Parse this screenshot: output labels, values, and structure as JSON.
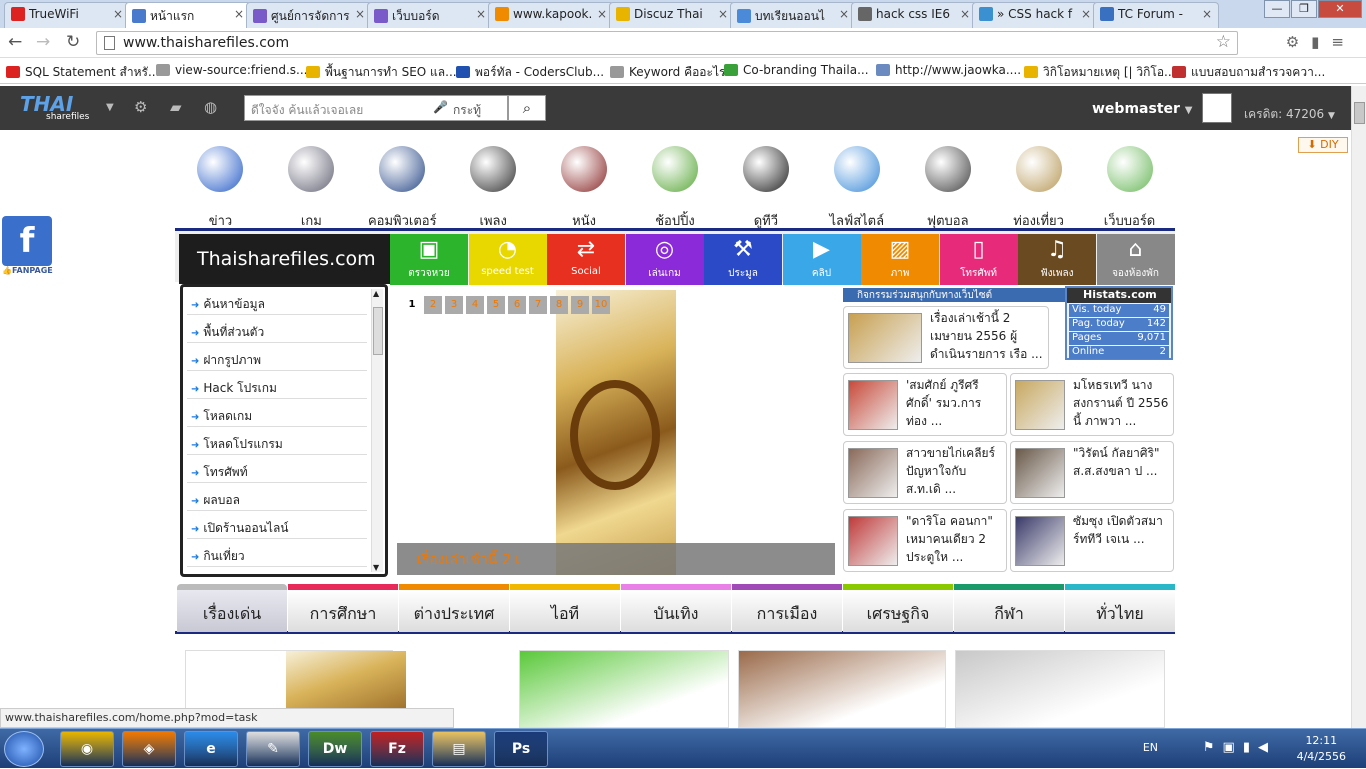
{
  "browser": {
    "tabs": [
      {
        "title": "TrueWiFi",
        "color": "#d22"
      },
      {
        "title": "หน้าแรก",
        "color": "#4a7acc"
      },
      {
        "title": "ศูนย์การจัดการ",
        "color": "#7a59c8"
      },
      {
        "title": "เว็บบอร์ด",
        "color": "#7a59c8"
      },
      {
        "title": "www.kapook.",
        "color": "#f08a00"
      },
      {
        "title": "Discuz Thai",
        "color": "#e8b400"
      },
      {
        "title": "บทเรียนออนไ",
        "color": "#4a8ad8"
      },
      {
        "title": "hack css IE6",
        "color": "#666"
      },
      {
        "title": "» CSS hack f",
        "color": "#3a90d0"
      },
      {
        "title": "TC Forum -",
        "color": "#3a70c0"
      }
    ],
    "url": "www.thaisharefiles.com",
    "bookmarks": [
      {
        "label": "SQL Statement สำหรั...",
        "color": "#d22"
      },
      {
        "label": "view-source:friend.s...",
        "color": "#999"
      },
      {
        "label": "พื้นฐานการทำ SEO แล...",
        "color": "#e8b400"
      },
      {
        "label": "พอร์ทัล - CodersClub...",
        "color": "#2050b0"
      },
      {
        "label": "Keyword คืออะไร",
        "color": "#999"
      },
      {
        "label": "Co-branding Thaila...",
        "color": "#3aa03a"
      },
      {
        "label": "http://www.jaowka....",
        "color": "#6a8ac0"
      },
      {
        "label": "วิกิโอหมายเหตุ [| วิกิโอ...",
        "color": "#e8b400"
      },
      {
        "label": "แบบสอบถามสำรวจควา...",
        "color": "#c03030"
      }
    ],
    "status_url": "www.thaisharefiles.com/home.php?mod=task"
  },
  "site": {
    "logo_big": "THAI",
    "logo_small": "sharefiles",
    "search_placeholder": "ดีใจจัง ค้นแล้วเจอเลย",
    "search_scope": "กระทู้",
    "username": "webmaster",
    "credit": "เครดิต: 47206",
    "diy": "DIY",
    "fanpage": "FANPAGE",
    "categories": [
      {
        "label": "ข่าว",
        "color": "#2a5fc8"
      },
      {
        "label": "เกม",
        "color": "#667"
      },
      {
        "label": "คอมพิวเตอร์",
        "color": "#2a4a88"
      },
      {
        "label": "เพลง",
        "color": "#333"
      },
      {
        "label": "หนัง",
        "color": "#8a2a2a"
      },
      {
        "label": "ช้อปปิ้ง",
        "color": "#5aa83a"
      },
      {
        "label": "ดูทีวี",
        "color": "#222"
      },
      {
        "label": "ไลฟ์สไตล์",
        "color": "#3a8ad8"
      },
      {
        "label": "ฟุตบอล",
        "color": "#444"
      },
      {
        "label": "ท่องเที่ยว",
        "color": "#b89a5a"
      },
      {
        "label": "เว็บบอร์ด",
        "color": "#6ab85a"
      }
    ],
    "brand": "Thaisharefiles.com",
    "color_blocks": [
      {
        "label": "ตรวจหวย",
        "icon": "▣",
        "color": "#2cb52c"
      },
      {
        "label": "speed test",
        "icon": "◔",
        "color": "#e8d800"
      },
      {
        "label": "Social",
        "icon": "⇄",
        "color": "#e83020"
      },
      {
        "label": "เล่นเกม",
        "icon": "◎",
        "color": "#8a2ad8"
      },
      {
        "label": "ประมูล",
        "icon": "⚒",
        "color": "#2a4ac8"
      },
      {
        "label": "คลิป",
        "icon": "▶",
        "color": "#3aa8e8"
      },
      {
        "label": "ภาพ",
        "icon": "▨",
        "color": "#f08a00"
      },
      {
        "label": "โทรศัพท์",
        "icon": "▯",
        "color": "#e82a7a"
      },
      {
        "label": "ฟังเพลง",
        "icon": "♫",
        "color": "#6a4a20"
      },
      {
        "label": "จองห้องพัก",
        "icon": "⌂",
        "color": "#888"
      }
    ],
    "left_menu": [
      "ค้นหาข้อมูล",
      "พื้นที่ส่วนตัว",
      "ฝากรูปภาพ",
      "Hack โปรเกม",
      "โหลดเกม",
      "โหลดโปรแกรม",
      "โทรศัพท์",
      "ผลบอล",
      "เปิดร้านออนไลน์",
      "กินเที่ยว"
    ],
    "slider": {
      "pages": [
        "1",
        "2",
        "3",
        "4",
        "5",
        "6",
        "7",
        "8",
        "9",
        "10"
      ],
      "caption": "เรื่องเล่าเช้านี้ 2 เ"
    },
    "activity_label": "กิจกรรมร่วมสนุกกับทางเว็บไซต์",
    "histats": {
      "title": "Histats.com",
      "rows": [
        {
          "k": "Vis. today",
          "v": "49"
        },
        {
          "k": "Pag. today",
          "v": "142"
        },
        {
          "k": "Pages",
          "v": "9,071"
        },
        {
          "k": "Online",
          "v": "2"
        }
      ]
    },
    "news": [
      {
        "text": "เรื่องเล่าเช้านี้ 2 เมษายน 2556 ผู้ดำเนินรายการ เรือ ...",
        "color": "#c8a050"
      },
      {
        "text": "'สมศักย์ ภูรีศรีศักดิ์' รมว.การท่อง ...",
        "color": "#c84a3a"
      },
      {
        "text": "มโหธรเทวี นางสงกรานต์ ปี 2556 นี้ ภาพวา ...",
        "color": "#c8a860"
      },
      {
        "text": "สาวขายไก่เคลียร์ปัญหาใจกับ ส.ท.เดิ ...",
        "color": "#8a6a5a"
      },
      {
        "text": "\"วิรัตน์ กัลยาศิริ\" ส.ส.สงขลา ป ...",
        "color": "#6a5a4a"
      },
      {
        "text": "\"ดาริโอ คอนกา\" เหมาคนเดียว 2 ประตูให ...",
        "color": "#c03a3a"
      },
      {
        "text": "ซัมซุง เปิดตัวสมาร์ททีวี เจเน ...",
        "color": "#3a3a6a"
      }
    ],
    "nav_tabs": [
      {
        "label": "เรื่องเด่น",
        "color": "#bbb"
      },
      {
        "label": "การศึกษา",
        "color": "#e82a5a"
      },
      {
        "label": "ต่างประเทศ",
        "color": "#f08a00"
      },
      {
        "label": "ไอที",
        "color": "#f0b800"
      },
      {
        "label": "บันเทิง",
        "color": "#e880e8"
      },
      {
        "label": "การเมือง",
        "color": "#a04ab8"
      },
      {
        "label": "เศรษฐกิจ",
        "color": "#8ac800"
      },
      {
        "label": "กีฬา",
        "color": "#1a9a6a"
      },
      {
        "label": "ทั่วไทย",
        "color": "#2ab8c8"
      }
    ],
    "bottom_images": [
      {
        "name": "slide-thumb",
        "color": "#d9b35a"
      },
      {
        "name": "politician-photo",
        "color": "#5ac83a"
      },
      {
        "name": "suspect-photo",
        "color": "#9a6a4a"
      },
      {
        "name": "football-photo",
        "color": "#c8c8c8"
      }
    ]
  },
  "taskbar": {
    "apps": [
      {
        "label": "◉",
        "color": "#e8b400"
      },
      {
        "label": "◈",
        "color": "#f07800"
      },
      {
        "label": "e",
        "color": "#2a8ae8"
      },
      {
        "label": "✎",
        "color": "#ddd"
      },
      {
        "label": "Dw",
        "color": "#4a8a2a"
      },
      {
        "label": "Fz",
        "color": "#c02020"
      },
      {
        "label": "▤",
        "color": "#e8c060"
      },
      {
        "label": "Ps",
        "color": "#1a3a7a"
      }
    ],
    "lang": "EN",
    "time": "12:11",
    "date": "4/4/2556"
  }
}
